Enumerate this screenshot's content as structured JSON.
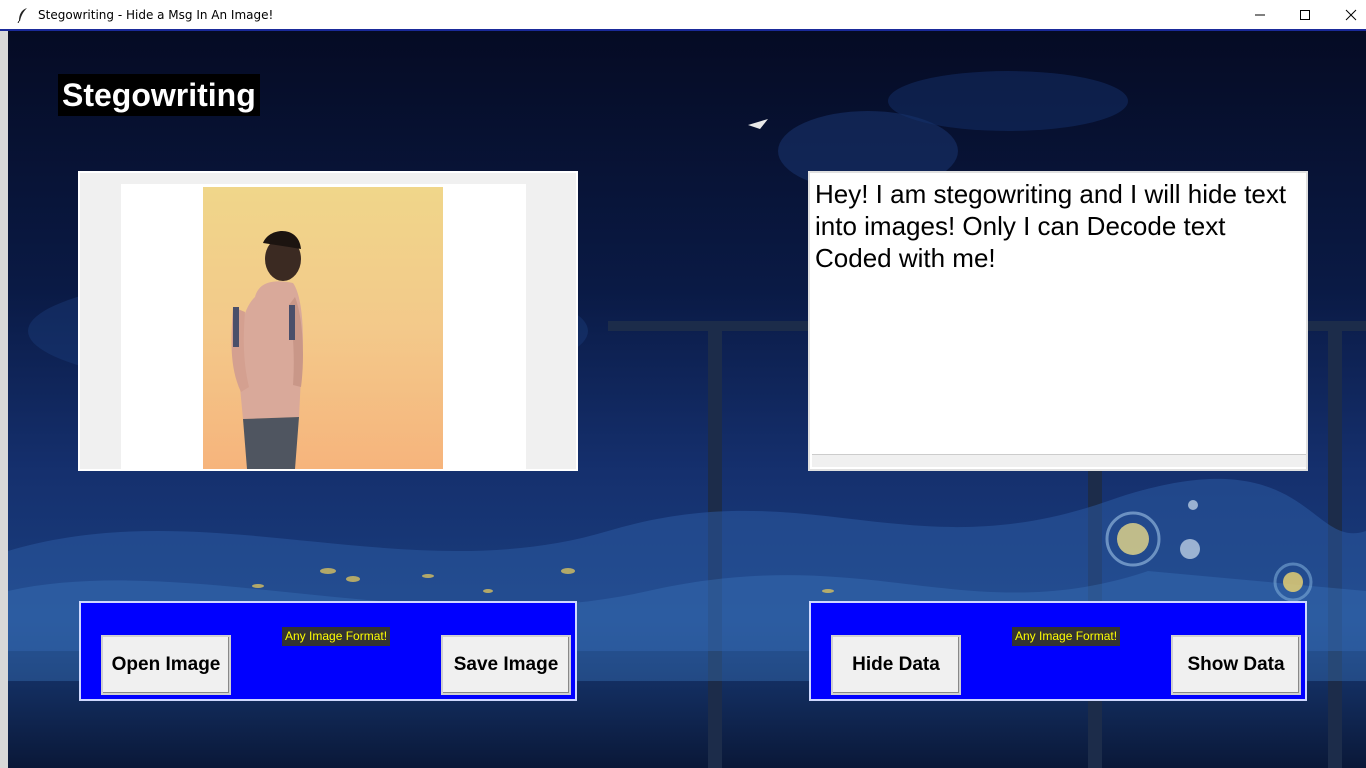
{
  "window": {
    "title": "Stegowriting - Hide a Msg In An Image!"
  },
  "heading": "Stegowriting",
  "text_area": {
    "value": "Hey! I am stegowriting and I will hide text into images! Only I can Decode text Coded with me!"
  },
  "left_controls": {
    "open_label": "Open Image",
    "hint": "Any Image Format!",
    "save_label": "Save Image"
  },
  "right_controls": {
    "hide_label": "Hide Data",
    "hint": "Any Image Format!",
    "show_label": "Show Data"
  },
  "colors": {
    "button_frame": "#0000ff",
    "hint_text": "#ffff00",
    "hint_bg": "#333333"
  }
}
